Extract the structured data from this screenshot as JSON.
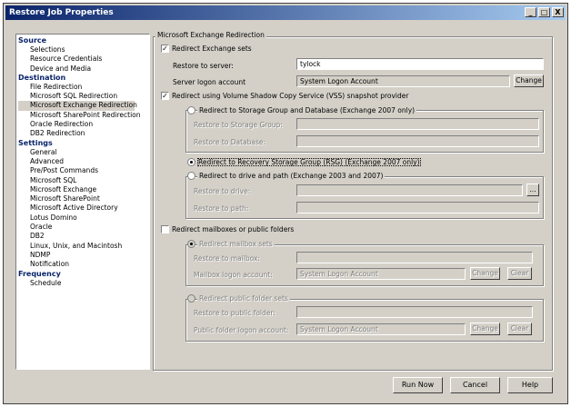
{
  "window": {
    "title": "Restore Job Properties",
    "controls": [
      "_",
      "□",
      "X"
    ]
  },
  "nav": {
    "sections": [
      {
        "head": "Source",
        "items": [
          "Selections",
          "Resource Credentials",
          "Device and Media"
        ]
      },
      {
        "head": "Destination",
        "items": [
          "File Redirection",
          "Microsoft SQL Redirection",
          "Microsoft Exchange Redirection",
          "Microsoft SharePoint Redirection",
          "Oracle Redirection",
          "DB2 Redirection"
        ]
      },
      {
        "head": "Settings",
        "items": [
          "General",
          "Advanced",
          "Pre/Post Commands",
          "Microsoft SQL",
          "Microsoft Exchange",
          "Microsoft SharePoint",
          "Microsoft Active Directory",
          "Lotus Domino",
          "Oracle",
          "DB2",
          "Linux, Unix, and Macintosh",
          "NDMP",
          "Notification"
        ]
      },
      {
        "head": "Frequency",
        "items": [
          "Schedule"
        ]
      }
    ],
    "selected": "Microsoft Exchange Redirection"
  },
  "main": {
    "group_title": "Microsoft Exchange Redirection",
    "redirect_sets_label": "Redirect Exchange sets",
    "restore_to_server_label": "Restore to server:",
    "restore_to_server_value": "tylock",
    "server_logon_label": "Server logon account",
    "server_logon_value": "System Logon Account",
    "change_label": "Change",
    "vss_label": "Redirect using Volume Shadow Copy Service (VSS) snapshot provider",
    "storage_group_radio": "Redirect to Storage Group and Database (Exchange 2007 only)",
    "restore_storage_group_label": "Restore to Storage Group:",
    "restore_database_label": "Restore to Database:",
    "rsg_radio": "Redirect to Recovery Storage Group (RSG) (Exchange 2007 only)",
    "drive_path_radio": "Redirect to drive and path (Exchange 2003 and 2007)",
    "restore_drive_label": "Restore to drive:",
    "restore_path_label": "Restore to path:",
    "browse_label": "...",
    "mailbox_check_label": "Redirect mailboxes or public folders",
    "mailbox_sets_radio": "Redirect mailbox sets",
    "restore_mailbox_label": "Restore to mailbox:",
    "mailbox_logon_label": "Mailbox logon account:",
    "mailbox_logon_value": "System Logon Account",
    "public_sets_radio": "Redirect public folder sets",
    "restore_public_label": "Restore to public folder:",
    "public_logon_label": "Public folder logon account:",
    "public_logon_value": "System Logon Account",
    "clear_label": "Clear"
  },
  "footer": {
    "run_now": "Run Now",
    "cancel": "Cancel",
    "help": "Help"
  }
}
